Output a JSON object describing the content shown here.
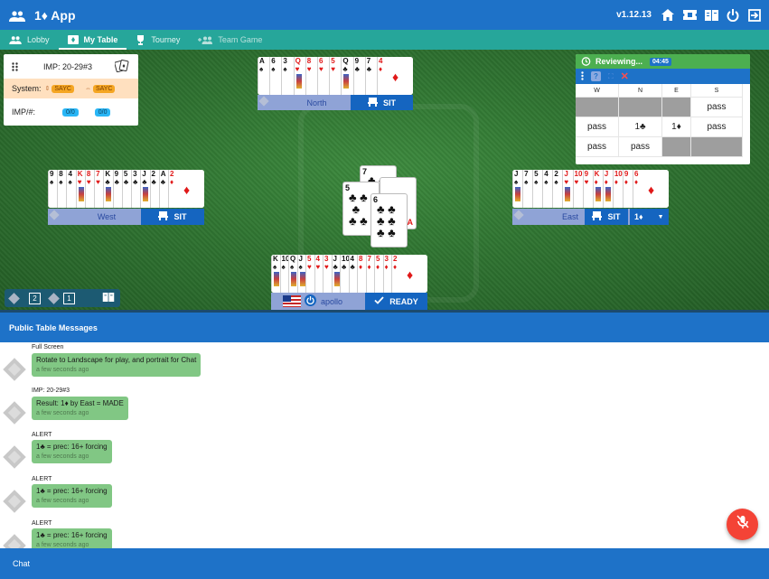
{
  "app": {
    "title": "1♦ App",
    "version": "v1.12.13"
  },
  "icons": [
    "people-icon",
    "home-icon",
    "ticket-icon",
    "book-icon",
    "power-icon",
    "exit-icon"
  ],
  "tabs": [
    {
      "label": "Lobby",
      "icon": "people-icon",
      "active": false
    },
    {
      "label": "My Table",
      "icon": "table-icon",
      "active": true
    },
    {
      "label": "Tourney",
      "icon": "trophy-icon",
      "active": false
    },
    {
      "label": "Team Game",
      "icon": "add-team-icon",
      "active": false,
      "disabled": true
    }
  ],
  "info": {
    "imp": "IMP: 20-29#3",
    "system_label": "System:",
    "system_ns": "SAYC",
    "system_ew": "SAYC",
    "imp_label": "IMP/#:",
    "imp_ns": "0/0",
    "imp_ew": "0/0"
  },
  "seats": {
    "north": {
      "name": "North",
      "sit": "SIT"
    },
    "west": {
      "name": "West",
      "sit": "SIT"
    },
    "east": {
      "name": "East",
      "sit": "SIT",
      "bid_badge": "1♦"
    },
    "south": {
      "name": "apollo",
      "ready": "READY"
    }
  },
  "hands": {
    "north": [
      "A♠",
      "6♠",
      "3♠",
      "Q♥",
      "8♥",
      "6♥",
      "5♥",
      "Q♣",
      "9♣",
      "7♣",
      "4♦"
    ],
    "west": [
      "9♠",
      "8♠",
      "4♠",
      "K♥",
      "8♥",
      "7♥",
      "K♣",
      "9♣",
      "5♣",
      "3♣",
      "J♣",
      "2♣",
      "A♣",
      "2♦"
    ],
    "east": [
      "J♠",
      "7♠",
      "5♠",
      "4♠",
      "2♠",
      "J♥",
      "10♥",
      "9♥",
      "K♦",
      "J♦",
      "10♦",
      "9♦",
      "6♦"
    ],
    "south": [
      "K♠",
      "10♠",
      "Q♠",
      "J♠",
      "5♥",
      "4♥",
      "3♥",
      "J♣",
      "10♣",
      "4♣",
      "8♦",
      "7♦",
      "5♦",
      "3♦",
      "2♦"
    ]
  },
  "trick": [
    {
      "rank": "7",
      "suit": "♣"
    },
    {
      "rank": "5",
      "suit": "♣"
    },
    {
      "rank": "6",
      "suit": "♣"
    },
    {
      "rank": "A",
      "suit": "♦"
    }
  ],
  "bidding": {
    "status": "Reviewing...",
    "timer": "04:45",
    "headers": [
      "W",
      "N",
      "E",
      "S"
    ],
    "rows": [
      [
        "",
        "",
        "",
        "pass"
      ],
      [
        "pass",
        "1♣",
        "1♦",
        "pass"
      ],
      [
        "pass",
        "pass",
        "",
        ""
      ]
    ]
  },
  "felt_controls": {
    "count_a": "2",
    "count_b": "1"
  },
  "messages": {
    "header": "Public Table Messages",
    "items": [
      {
        "from": "Full Screen",
        "text": "Rotate to Landscape for play, and portrait for Chat",
        "time": "a few seconds ago"
      },
      {
        "from": "IMP: 20-29#3",
        "text": "Result: 1♦ by East = MADE",
        "time": "a few seconds ago"
      },
      {
        "from": "ALERT",
        "text": "1♣ = prec: 16+ forcing",
        "time": "a few seconds ago"
      },
      {
        "from": "ALERT",
        "text": "1♣ = prec: 16+ forcing",
        "time": "a few seconds ago"
      },
      {
        "from": "ALERT",
        "text": "1♣ = prec: 16+ forcing",
        "time": "a few seconds ago"
      }
    ]
  },
  "chat": {
    "label": "Chat"
  },
  "colors": {
    "primary": "#1e72c8",
    "teal": "#26a69a",
    "felt": "#2f7431",
    "bubble": "#81c784",
    "fab": "#f44336",
    "bid_header": "#4caf50"
  }
}
